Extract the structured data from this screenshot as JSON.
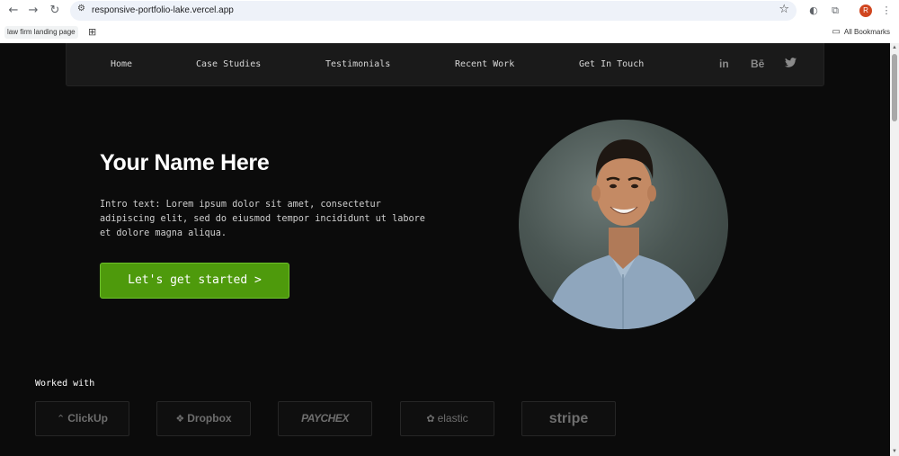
{
  "browser": {
    "url": "responsive-portfolio-lake.vercel.app",
    "bookmark": "law firm landing page",
    "all_bookmarks": "All Bookmarks",
    "profile_initial": "R"
  },
  "nav": {
    "links": [
      "Home",
      "Case Studies",
      "Testimonials",
      "Recent Work",
      "Get In Touch"
    ],
    "social": [
      "in",
      "Bē",
      "twitter"
    ]
  },
  "hero": {
    "title": "Your Name Here",
    "intro": "Intro text: Lorem ipsum dolor sit amet, consectetur adipiscing elit, sed do eiusmod tempor incididunt ut labore et dolore magna aliqua.",
    "cta": "Let's get started >"
  },
  "worked_with": {
    "label": "Worked with",
    "logos": [
      "ClickUp",
      "Dropbox",
      "PAYCHEX",
      "elastic",
      "stripe"
    ]
  },
  "colors": {
    "background": "#0b0b0b",
    "navbar": "#1a1a1a",
    "cta": "#4e9a0c"
  }
}
